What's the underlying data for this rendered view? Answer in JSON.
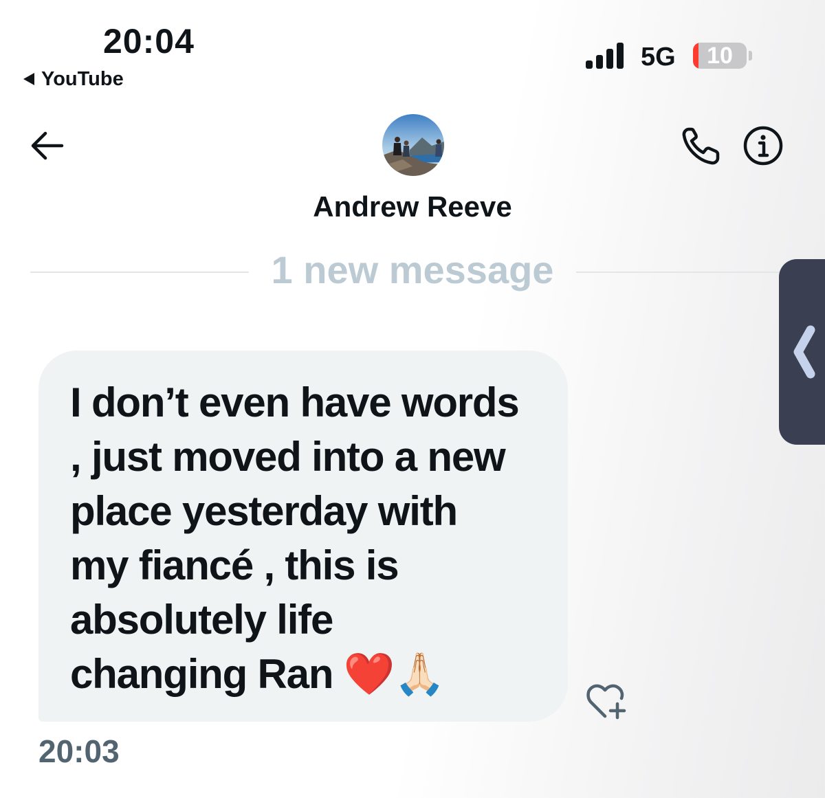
{
  "status_bar": {
    "time": "20:04",
    "back_app_label": "YouTube",
    "network": "5G",
    "battery_level": "10",
    "battery_fraction": 0.1,
    "battery_color": "#ff3b30"
  },
  "header": {
    "contact_name": "Andrew Reeve",
    "icons": [
      "back-arrow-icon",
      "phone-icon",
      "info-icon"
    ]
  },
  "divider": {
    "label": "1 new message"
  },
  "message": {
    "text": "I don’t even have words\n, just moved into a new\nplace yesterday with\nmy fiancé , this is\nabsolutely life\nchanging Ran ❤️🙏🏻",
    "time": "20:03",
    "bubble_color": "#eff3f4"
  },
  "colors": {
    "text": "#0f1419",
    "muted": "#536471",
    "divider_text": "#bccad4",
    "side_handle": "#3a3f52"
  }
}
